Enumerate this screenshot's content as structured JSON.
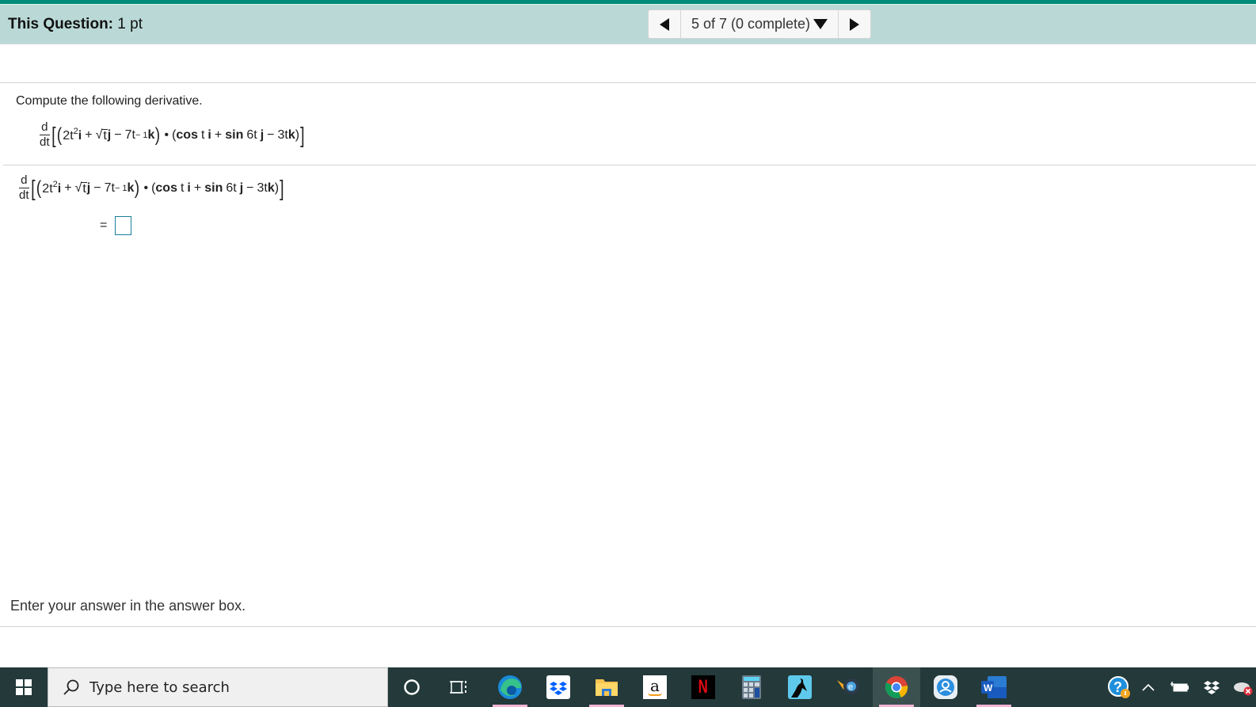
{
  "header": {
    "question_label": "This Question:",
    "question_points": "1 pt",
    "nav_selector": "5 of 7 (0 complete)",
    "prev_icon": "triangle-left-icon",
    "next_icon": "triangle-right-icon",
    "dropdown_icon": "triangle-down-icon"
  },
  "question": {
    "prompt": "Compute the following derivative.",
    "expression": {
      "d": "d",
      "dt": "dt",
      "open_bracket": "[",
      "open_paren": "(",
      "term1_coef": "2t",
      "term1_exp": "2",
      "i": "i",
      "plus1": "+",
      "sqrt_arg": "t",
      "j": "j",
      "minus1": "−",
      "term3_coef": "7t",
      "term3_exp": "− 1",
      "k": "k",
      "close_paren": ")",
      "dot": "•",
      "paren2_open": "(",
      "cos": "cos",
      "cos_arg": "t",
      "plus2": "+",
      "sin": "sin",
      "sin_arg": "6t",
      "minus2": "−",
      "term6_coef": "3t",
      "paren2_close": ")",
      "close_bracket": "]"
    },
    "equals": "=",
    "answer_value": ""
  },
  "footer": {
    "instructions": "Enter your answer in the answer box."
  },
  "taskbar": {
    "search_placeholder": "Type here to search",
    "apps": [
      "cortana",
      "task-view",
      "edge",
      "dropbox",
      "file-explorer",
      "amazon",
      "netflix",
      "calculator",
      "kindle",
      "internet-explorer-migration",
      "chrome",
      "people",
      "word"
    ],
    "amazon_label": "a",
    "netflix_label": "N",
    "word_label": "W"
  }
}
